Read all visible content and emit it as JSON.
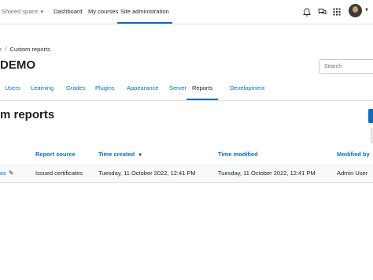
{
  "navbar": {
    "brand_label": "Shared space",
    "links": [
      "Dashboard",
      "My courses",
      "Site administration"
    ]
  },
  "breadcrumb": {
    "prev_fragment": "r",
    "current": "Custom reports"
  },
  "page": {
    "title": "DEMO"
  },
  "search": {
    "placeholder": "Search"
  },
  "tabs": [
    "Users",
    "Learning",
    "Grades",
    "Plugins",
    "Appearance",
    "Server",
    "Reports",
    "Development"
  ],
  "active_tab": "Reports",
  "section": {
    "title": "m reports"
  },
  "table": {
    "headers": [
      "Report source",
      "Time created",
      "Time modified",
      "Modified by"
    ],
    "rows": [
      {
        "name_fragment": "es",
        "source": "Issued certificates",
        "created": "Tuesday, 11 October 2022, 12:41 PM",
        "modified": "Tuesday, 11 October 2022, 12:41 PM",
        "modified_by": "Admin User"
      }
    ]
  },
  "colors": {
    "accent": "#0f6cbf",
    "text": "#1d2125"
  },
  "icons": [
    "chevron-down-icon",
    "bell-icon",
    "chat-icon",
    "grid-icon",
    "user-avatar",
    "sort-desc-icon",
    "pencil-icon"
  ]
}
